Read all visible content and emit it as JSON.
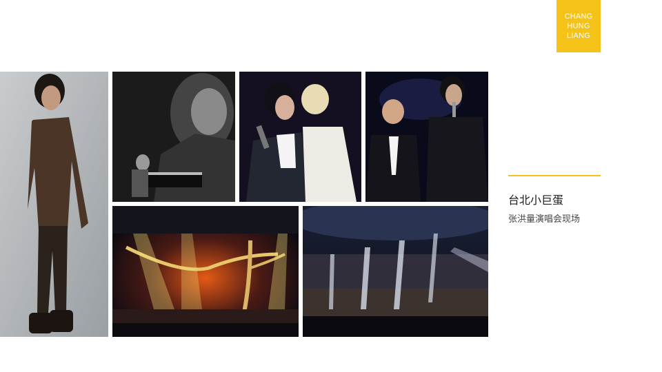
{
  "badge": {
    "lines": [
      "CHANG",
      "HUNG",
      "LIANG"
    ]
  },
  "caption": {
    "title": "台北小巨蛋",
    "subtitle": "张洪量演唱会现场"
  },
  "colors": {
    "accent": "#f5c21a",
    "text": "#1a1a1a",
    "muted": "#444444"
  },
  "photos": [
    {
      "id": "portrait",
      "subject": "singer portrait in long coat"
    },
    {
      "id": "piano",
      "subject": "black-and-white piano performance"
    },
    {
      "id": "duet",
      "subject": "duet on stage"
    },
    {
      "id": "guests",
      "subject": "singer with guest on stage"
    },
    {
      "id": "stage",
      "subject": "concert stage with golden tree"
    },
    {
      "id": "arena",
      "subject": "arena crowd with spotlights"
    }
  ]
}
